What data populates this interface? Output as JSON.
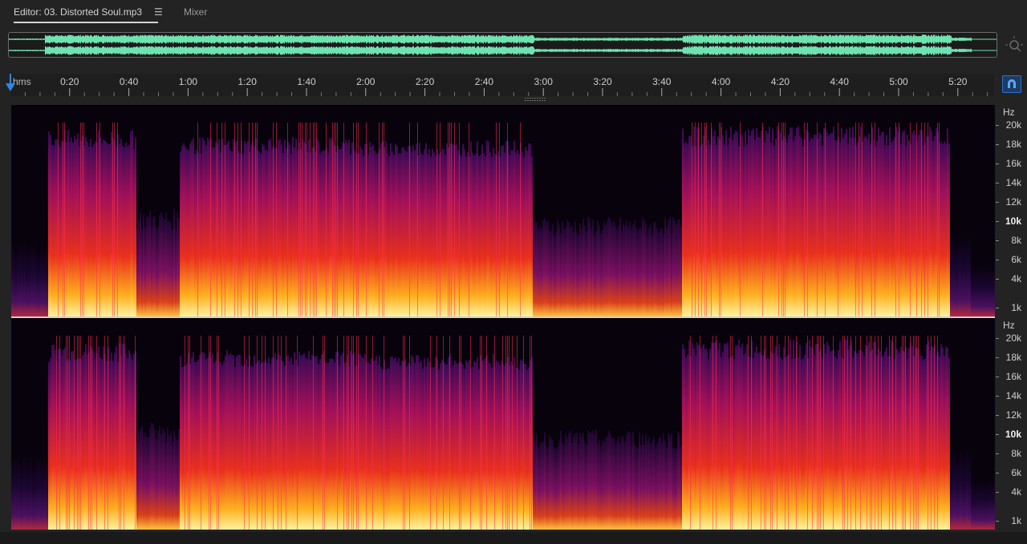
{
  "tabs": {
    "editor_label": "Editor: 03. Distorted Soul.mp3",
    "menu_icon": "hamburger-menu-icon",
    "mixer_label": "Mixer"
  },
  "ruler": {
    "unit": "hms",
    "ticks": [
      "0:20",
      "0:40",
      "1:00",
      "1:20",
      "1:40",
      "2:00",
      "2:20",
      "2:40",
      "3:00",
      "3:20",
      "3:40",
      "4:00",
      "4:20",
      "4:40",
      "5:00",
      "5:20"
    ]
  },
  "frequency_scale": {
    "unit": "Hz",
    "labels": [
      "20k",
      "18k",
      "16k",
      "14k",
      "12k",
      "10k",
      "8k",
      "6k",
      "4k",
      "1k"
    ],
    "emphasized": "10k"
  },
  "colors": {
    "waveform": "#6ee3b0",
    "playhead": "#2f86e6",
    "spectrogram_low": "#08020c",
    "spectrogram_mid": "#c8202a",
    "spectrogram_high": "#ffe97a"
  }
}
